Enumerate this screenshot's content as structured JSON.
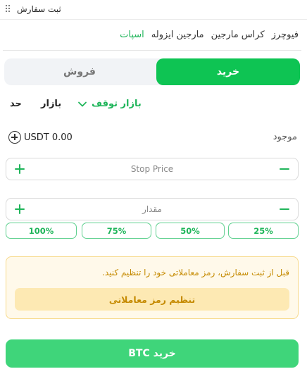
{
  "window": {
    "title": "ثبت سفارش",
    "drag_icon": "grip-dots-icon"
  },
  "tabs": [
    {
      "label": "اسپات",
      "active": true
    },
    {
      "label": "مارجین ایزوله",
      "active": false
    },
    {
      "label": "کراس مارجین",
      "active": false
    },
    {
      "label": "فیوچرز",
      "active": false
    }
  ],
  "side_toggle": {
    "buy_label": "خرید",
    "sell_label": "فروش",
    "selected": "buy"
  },
  "order_types": {
    "limit": "حد",
    "market": "بازار",
    "stop": "بازار توقف",
    "stop_icon": "chevron-down-icon",
    "selected": "stop"
  },
  "balance": {
    "label": "موجود",
    "value": "USDT 0.00",
    "add_icon": "plus-circle-icon"
  },
  "stop_price": {
    "placeholder": "Stop Price",
    "value": ""
  },
  "quantity": {
    "placeholder": "مقدار",
    "value": ""
  },
  "percentages": [
    "100%",
    "75%",
    "50%",
    "25%"
  ],
  "notice": {
    "message": "قبل از ثبت سفارش، رمز معاملاتی خود را تنظیم کنید.",
    "button_label": "تنظیم رمز معاملاتی"
  },
  "submit": {
    "label": "خرید BTC"
  },
  "colors": {
    "accent": "#0ec453",
    "accent_text": "#1fb55a",
    "submit": "#3fd57a",
    "notice_bg": "#fff9ea",
    "notice_text": "#c58a00"
  }
}
